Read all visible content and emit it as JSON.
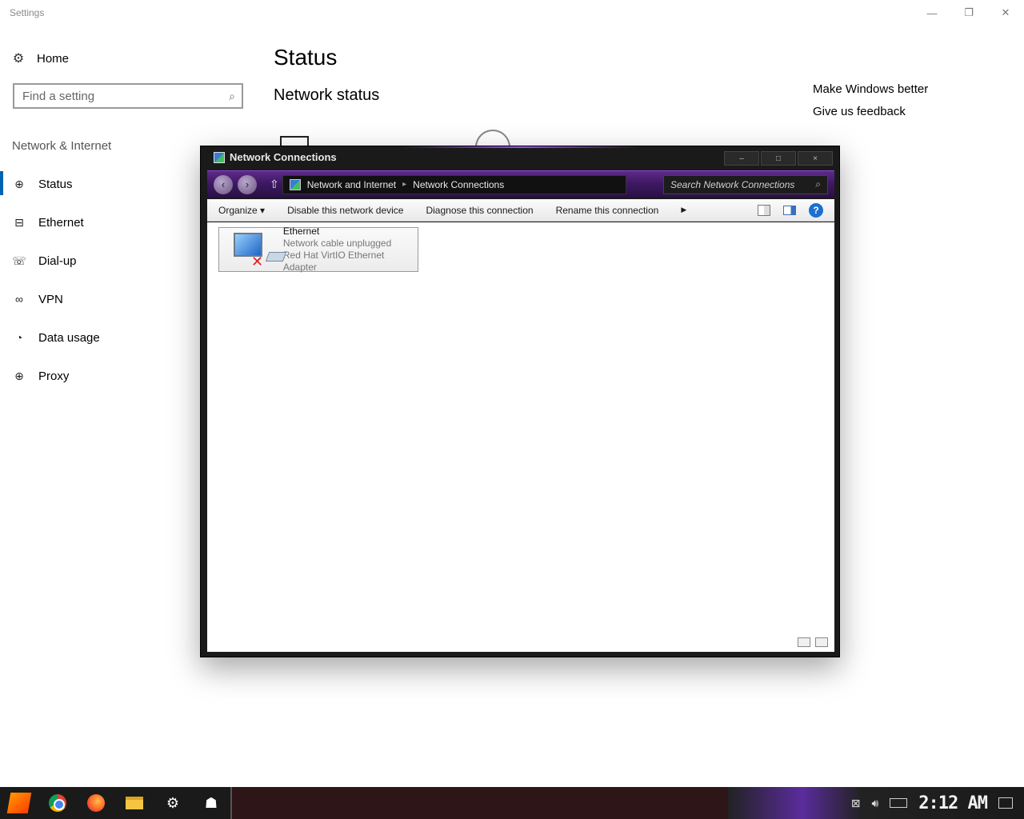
{
  "settings": {
    "app_title": "Settings",
    "window_controls": {
      "minimize": "—",
      "restore": "❐",
      "close": "✕"
    },
    "home_label": "Home",
    "search": {
      "placeholder": "Find a setting"
    },
    "section_label": "Network & Internet",
    "sidebar": {
      "items": [
        {
          "label": "Status",
          "icon": "globe-icon"
        },
        {
          "label": "Ethernet",
          "icon": "ethernet-icon"
        },
        {
          "label": "Dial-up",
          "icon": "dialup-icon"
        },
        {
          "label": "VPN",
          "icon": "vpn-icon"
        },
        {
          "label": "Data usage",
          "icon": "data-usage-icon"
        },
        {
          "label": "Proxy",
          "icon": "globe-icon"
        }
      ]
    },
    "page_title": "Status",
    "sub_title": "Network status",
    "related": {
      "make_better": "Make Windows better",
      "feedback": "Give us feedback"
    }
  },
  "network_connections": {
    "title": "Network Connections",
    "controls": {
      "minimize": "–",
      "maximize": "□",
      "close": "×"
    },
    "breadcrumb": [
      "Network and Internet",
      "Network Connections"
    ],
    "search": {
      "placeholder": "Search Network Connections"
    },
    "commands": {
      "organize": "Organize",
      "disable": "Disable this network device",
      "diagnose": "Diagnose this connection",
      "rename": "Rename this connection"
    },
    "connection": {
      "name": "Ethernet",
      "status": "Network cable unplugged",
      "adapter": "Red Hat VirtIO Ethernet Adapter"
    }
  },
  "taskbar": {
    "clock": "2:12 AM"
  },
  "colors": {
    "accent": "#0063b1",
    "window_frame": "#1a1a1a",
    "address_purple": "#5e2a8a",
    "error_red": "#e01b1b"
  }
}
